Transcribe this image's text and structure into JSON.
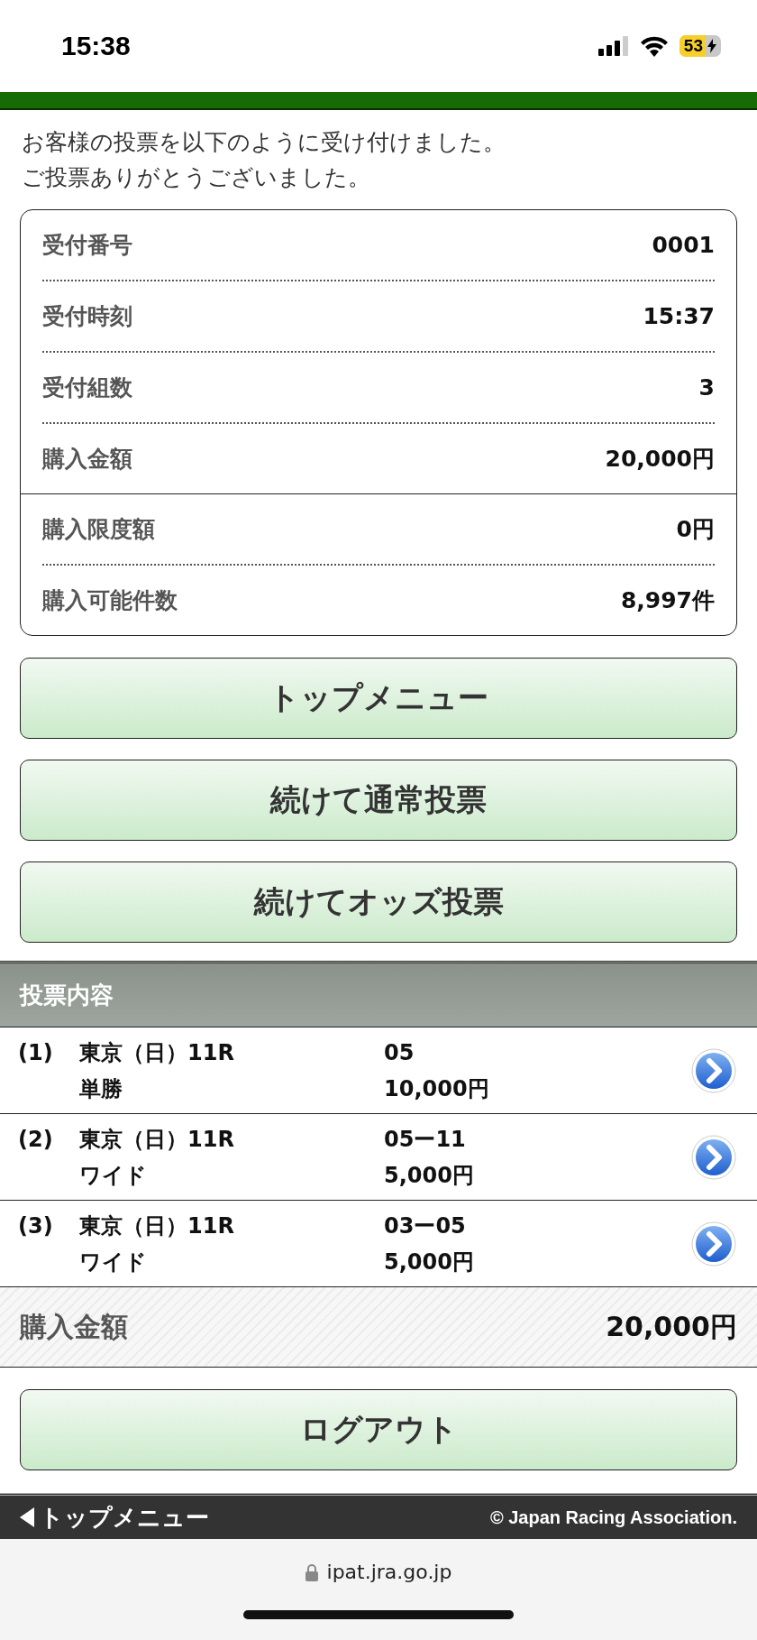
{
  "status_bar": {
    "time": "15:38",
    "battery": "53"
  },
  "message": [
    "お客様の投票を以下のように受け付けました。",
    "ご投票ありがとうございました。"
  ],
  "receipt": {
    "groups": [
      [
        {
          "label": "受付番号",
          "value": "0001"
        },
        {
          "label": "受付時刻",
          "value": "15:37"
        },
        {
          "label": "受付組数",
          "value": "3"
        },
        {
          "label": "購入金額",
          "value": "20,000円"
        }
      ],
      [
        {
          "label": "購入限度額",
          "value": "0円"
        },
        {
          "label": "購入可能件数",
          "value": "8,997件"
        }
      ]
    ]
  },
  "buttons": [
    "トップメニュー",
    "続けて通常投票",
    "続けてオッズ投票"
  ],
  "bets": {
    "title": "投票内容",
    "rows": [
      {
        "index": "(1)",
        "race": "東京（日）11R",
        "type": "単勝",
        "numbers": "05",
        "amount": "10,000円"
      },
      {
        "index": "(2)",
        "race": "東京（日）11R",
        "type": "ワイド",
        "numbers": "05ー11",
        "amount": "5,000円"
      },
      {
        "index": "(3)",
        "race": "東京（日）11R",
        "type": "ワイド",
        "numbers": "03ー05",
        "amount": "5,000円"
      }
    ]
  },
  "total": {
    "label": "購入金額",
    "value": "20,000円"
  },
  "logout_button": "ログアウト",
  "footer": {
    "link": "トップメニュー",
    "copyright": "© Japan Racing Association."
  },
  "browser": {
    "url": "ipat.jra.go.jp"
  }
}
